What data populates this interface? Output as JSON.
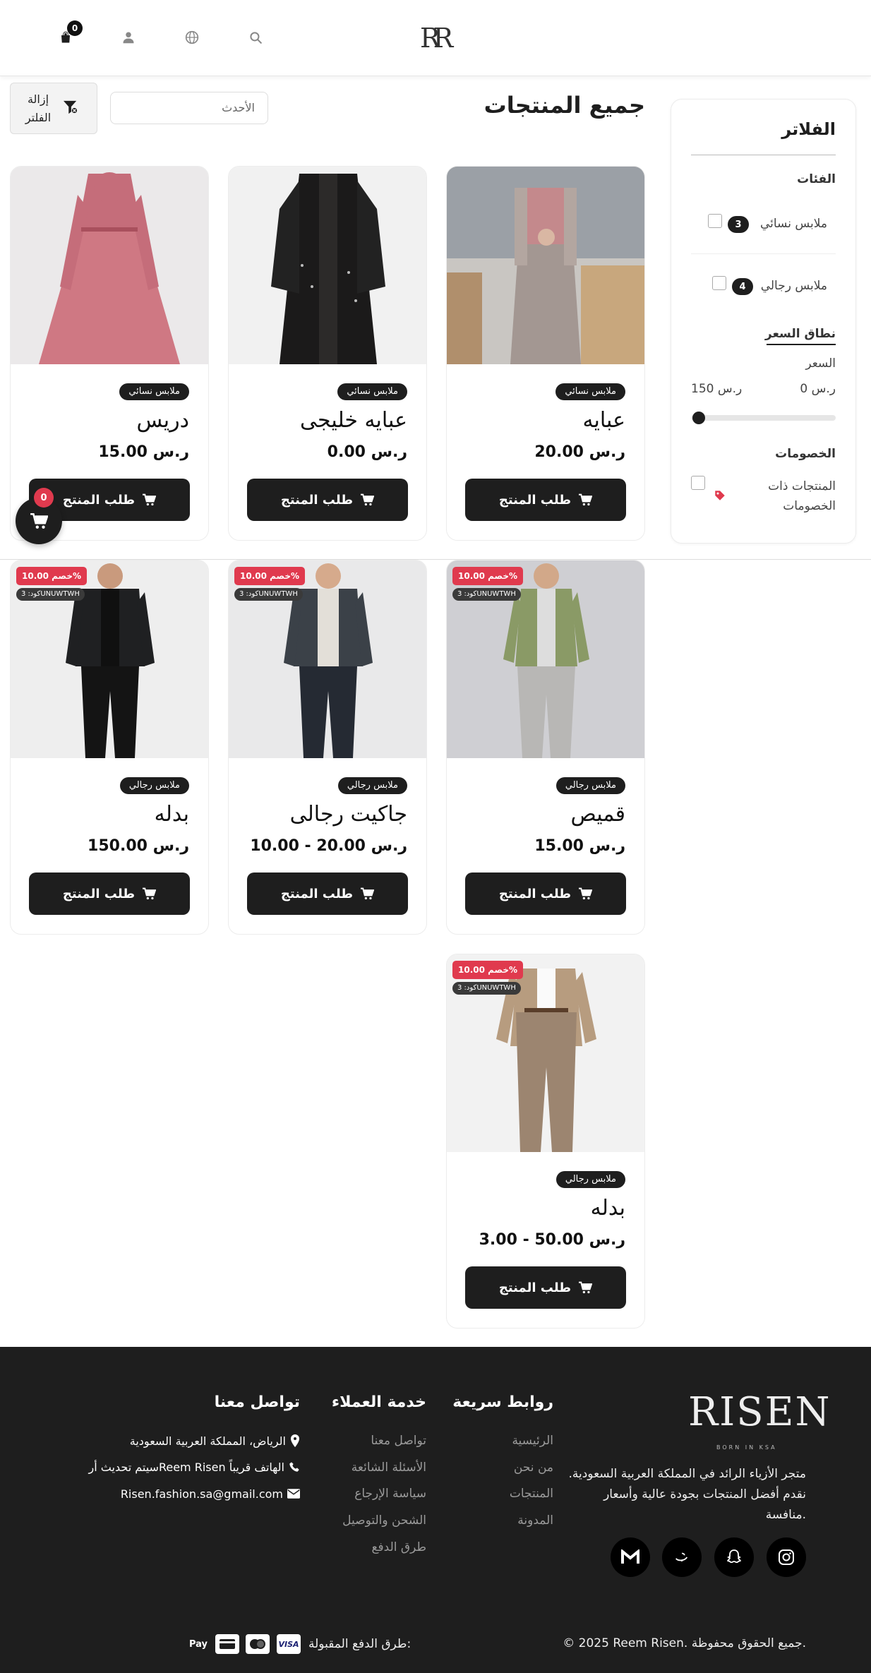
{
  "header": {
    "cart_count": "0",
    "logo_text": "RR"
  },
  "filters": {
    "title": "الفلاتر",
    "categories_label": "الفئات",
    "categories": [
      {
        "label": "ملابس نسائي",
        "count": "3"
      },
      {
        "label": "ملابس رجالي",
        "count": "4"
      }
    ],
    "price_range_label": "نطاق السعر",
    "price_label": "السعر",
    "price_min": "0 ر.س",
    "price_max": "150 ر.س",
    "price_slider_position": 0,
    "discounts_label": "الخصومات",
    "discounted_products_label": "المنتجات ذات الخصومات"
  },
  "main": {
    "page_title": "جميع المنتجات",
    "sort_value": "الأحدث",
    "clear_filter_label": "إزالة الفلتر"
  },
  "products": [
    {
      "name": "عبايه",
      "category": "ملابس نسائي",
      "price": "20.00 ر.س",
      "button": "طلب المنتج"
    },
    {
      "name": "عبايه خليجى",
      "category": "ملابس نسائي",
      "price": "0.00 ر.س",
      "button": "طلب المنتج"
    },
    {
      "name": "دريس",
      "category": "ملابس نسائي",
      "price": "15.00 ر.س",
      "button": "طلب المنتج"
    },
    {
      "name": "قميص",
      "category": "ملابس رجالي",
      "price": "15.00 ر.س",
      "button": "طلب المنتج",
      "discount": "خصم 10.00%",
      "code": "كود: 3UNUWTWH"
    },
    {
      "name": "جاكيت رجالى",
      "category": "ملابس رجالي",
      "price": "10.00 - 20.00 ر.س",
      "button": "طلب المنتج",
      "discount": "خصم 10.00%",
      "code": "كود: 3UNUWTWH"
    },
    {
      "name": "بدله",
      "category": "ملابس رجالي",
      "price": "150.00 ر.س",
      "button": "طلب المنتج",
      "discount": "خصم 10.00%",
      "code": "كود: 3UNUWTWH"
    },
    {
      "name": "بدله",
      "category": "ملابس رجالي",
      "price": "3.00 - 50.00 ر.س",
      "button": "طلب المنتج",
      "discount": "خصم 10.00%",
      "code": "كود: 3UNUWTWH"
    }
  ],
  "floating_cart": {
    "count": "0"
  },
  "footer": {
    "logo": "RISEN",
    "tagline": "BORN IN KSA",
    "about": "متجر الأزياء الرائد في المملكة العربية السعودية. نقدم أفضل المنتجات بجودة عالية وأسعار منافسة.",
    "quick_links_title": "روابط سريعة",
    "quick_links": [
      "الرئيسية",
      "من نحن",
      "المنتجات",
      "المدونة"
    ],
    "customer_service_title": "خدمة العملاء",
    "customer_service_links": [
      "تواصل معنا",
      "الأسئلة الشائعة",
      "سياسة الإرجاع",
      "الشحن والتوصيل",
      "طرق الدفع"
    ],
    "contact_title": "تواصل معنا",
    "contact_address": "الرياض، المملكة العربية السعودية",
    "contact_phone": "سيتم تحديث أرReem Risen الهاتف قريباً",
    "contact_email": "Risen.fashion.sa@gmail.com",
    "copyright": "© 2025 Reem Risen. جميع الحقوق محفوظة.",
    "payment_label": "طرق الدفع المقبولة:",
    "payment_methods": [
      "VISA",
      "mastercard",
      "card",
      "Apple Pay"
    ],
    "apple_pay_text": "Pay",
    "visa_text": "VISA"
  }
}
